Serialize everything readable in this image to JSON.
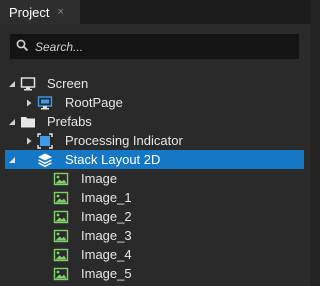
{
  "panel": {
    "title": "Project",
    "close_glyph": "×"
  },
  "search": {
    "placeholder": "Search..."
  },
  "tree": {
    "screen": {
      "label": "Screen",
      "icon": "monitor-icon"
    },
    "root_page": {
      "label": "RootPage",
      "icon": "page-icon"
    },
    "prefabs": {
      "label": "Prefabs",
      "icon": "folder-icon"
    },
    "processing_indicator": {
      "label": "Processing Indicator",
      "icon": "node-box-icon"
    },
    "stack_layout": {
      "label": "Stack Layout 2D",
      "icon": "layers-icon",
      "selected": true
    },
    "images": [
      {
        "label": "Image"
      },
      {
        "label": "Image_1"
      },
      {
        "label": "Image_2"
      },
      {
        "label": "Image_3"
      },
      {
        "label": "Image_4"
      },
      {
        "label": "Image_5"
      }
    ]
  },
  "colors": {
    "selection": "#1578c6",
    "background": "#2a2a2a",
    "icon_green": "#7fcf6a",
    "icon_blue": "#3d9be9"
  }
}
